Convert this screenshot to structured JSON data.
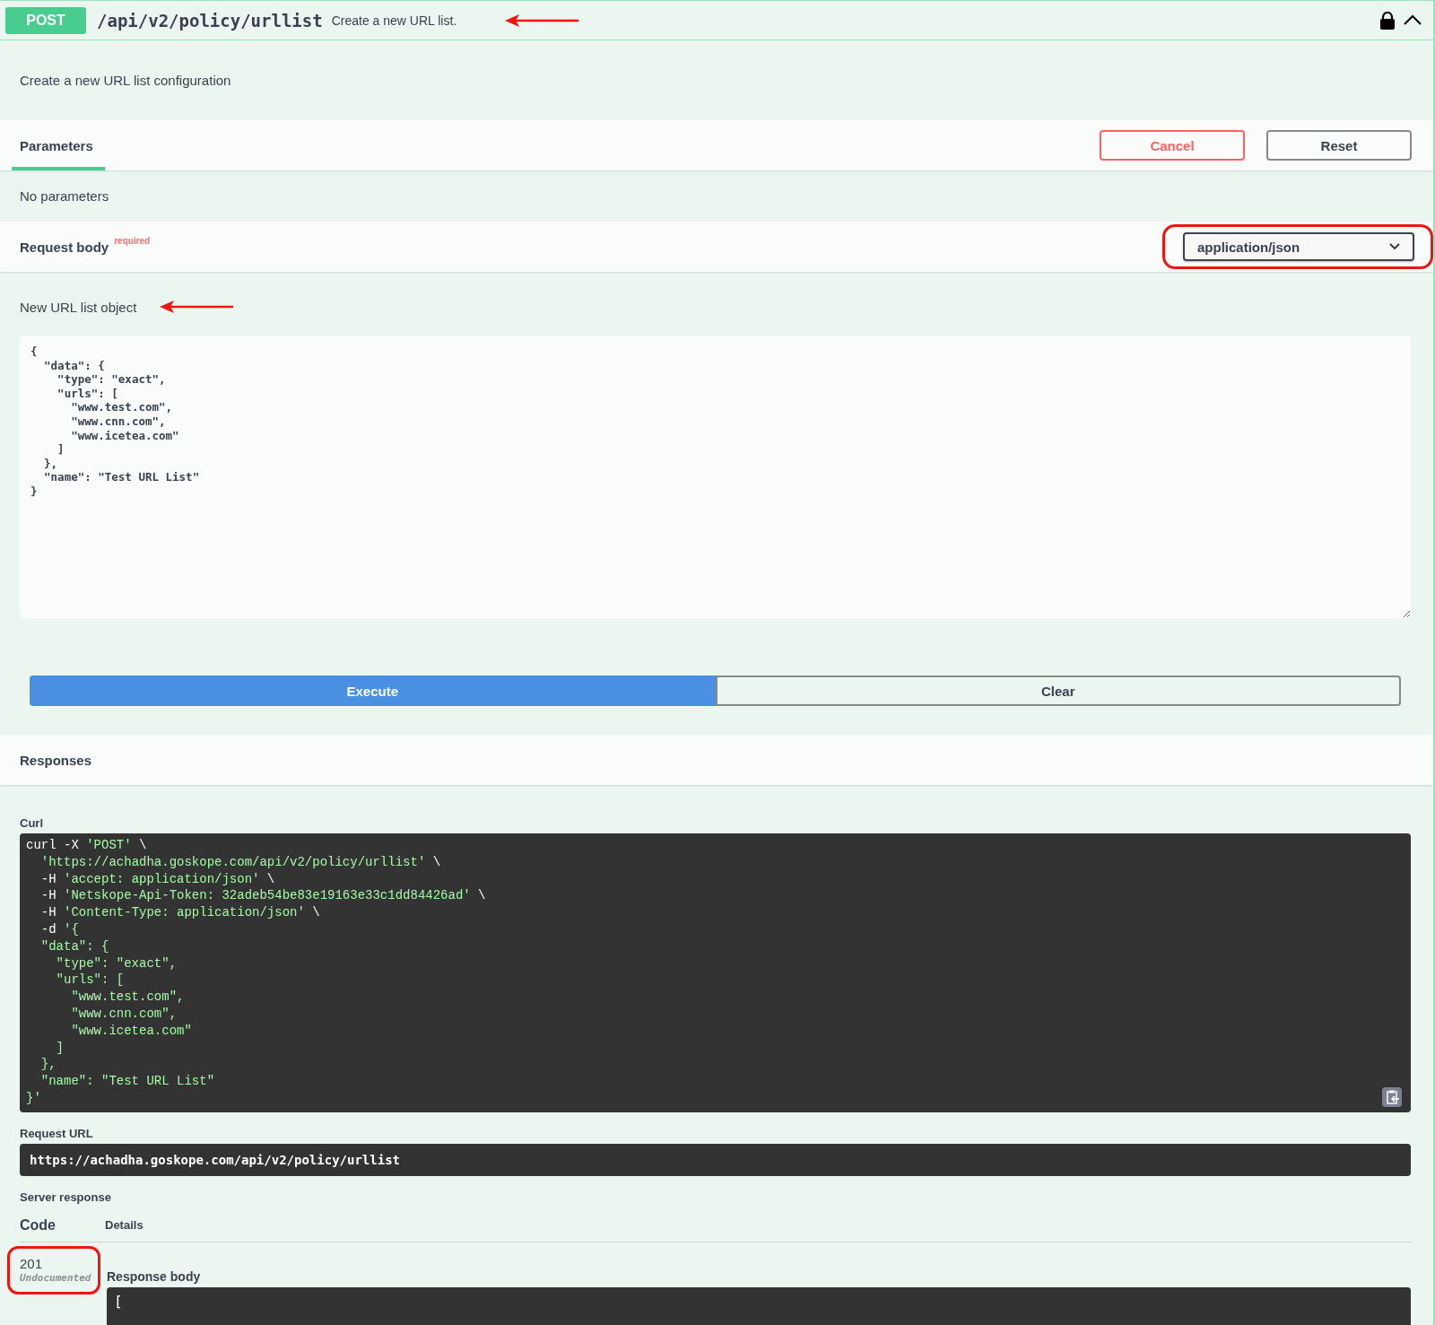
{
  "operation": {
    "method": "POST",
    "path": "/api/v2/policy/urllist",
    "summary": "Create a new URL list.",
    "summary_annotation": {
      "kind": "arrow"
    },
    "locked": true,
    "expanded": true
  },
  "description": "Create a new URL list configuration",
  "parameters": {
    "tabs": [
      {
        "label": "Parameters",
        "selected": true
      }
    ],
    "buttons": [
      {
        "label": "Cancel",
        "kind": "cancel"
      },
      {
        "label": "Reset",
        "kind": "reset"
      }
    ],
    "empty_text": "No parameters"
  },
  "request_body": {
    "title": "Request body",
    "required_label": "required",
    "content_type": "application/json",
    "content_type_annotation": {
      "kind": "ring"
    },
    "description": "New URL list object",
    "description_annotation": {
      "kind": "arrow"
    },
    "value": "{\n  \"data\": {\n    \"type\": \"exact\",\n    \"urls\": [\n      \"www.test.com\",\n      \"www.cnn.com\",\n      \"www.icetea.com\"\n    ]\n  },\n  \"name\": \"Test URL List\"\n}"
  },
  "actions": [
    {
      "label": "Execute",
      "kind": "primary"
    },
    {
      "label": "Clear",
      "kind": "secondary"
    }
  ],
  "responses": {
    "title": "Responses",
    "curl_label": "Curl",
    "curl": "curl -X 'POST' \\\n  'https://achadha.goskope.com/api/v2/policy/urllist' \\\n  -H 'accept: application/json' \\\n  -H 'Netskope-Api-Token: 32adeb54be83e19163e33c1dd84426ad' \\\n  -H 'Content-Type: application/json' \\\n  -d '{\n  \"data\": {\n    \"type\": \"exact\",\n    \"urls\": [\n      \"www.test.com\",\n      \"www.cnn.com\",\n      \"www.icetea.com\"\n    ]\n  },\n  \"name\": \"Test URL List\"\n}'",
    "request_url_label": "Request URL",
    "request_url": "https://achadha.goskope.com/api/v2/policy/urllist",
    "server_response_label": "Server response",
    "columns": [
      "Code",
      "Details"
    ],
    "rows": [
      {
        "code": "201",
        "note": "Undocumented",
        "body_label": "Response body",
        "body": "[",
        "annotation": {
          "kind": "ring"
        }
      }
    ]
  }
}
